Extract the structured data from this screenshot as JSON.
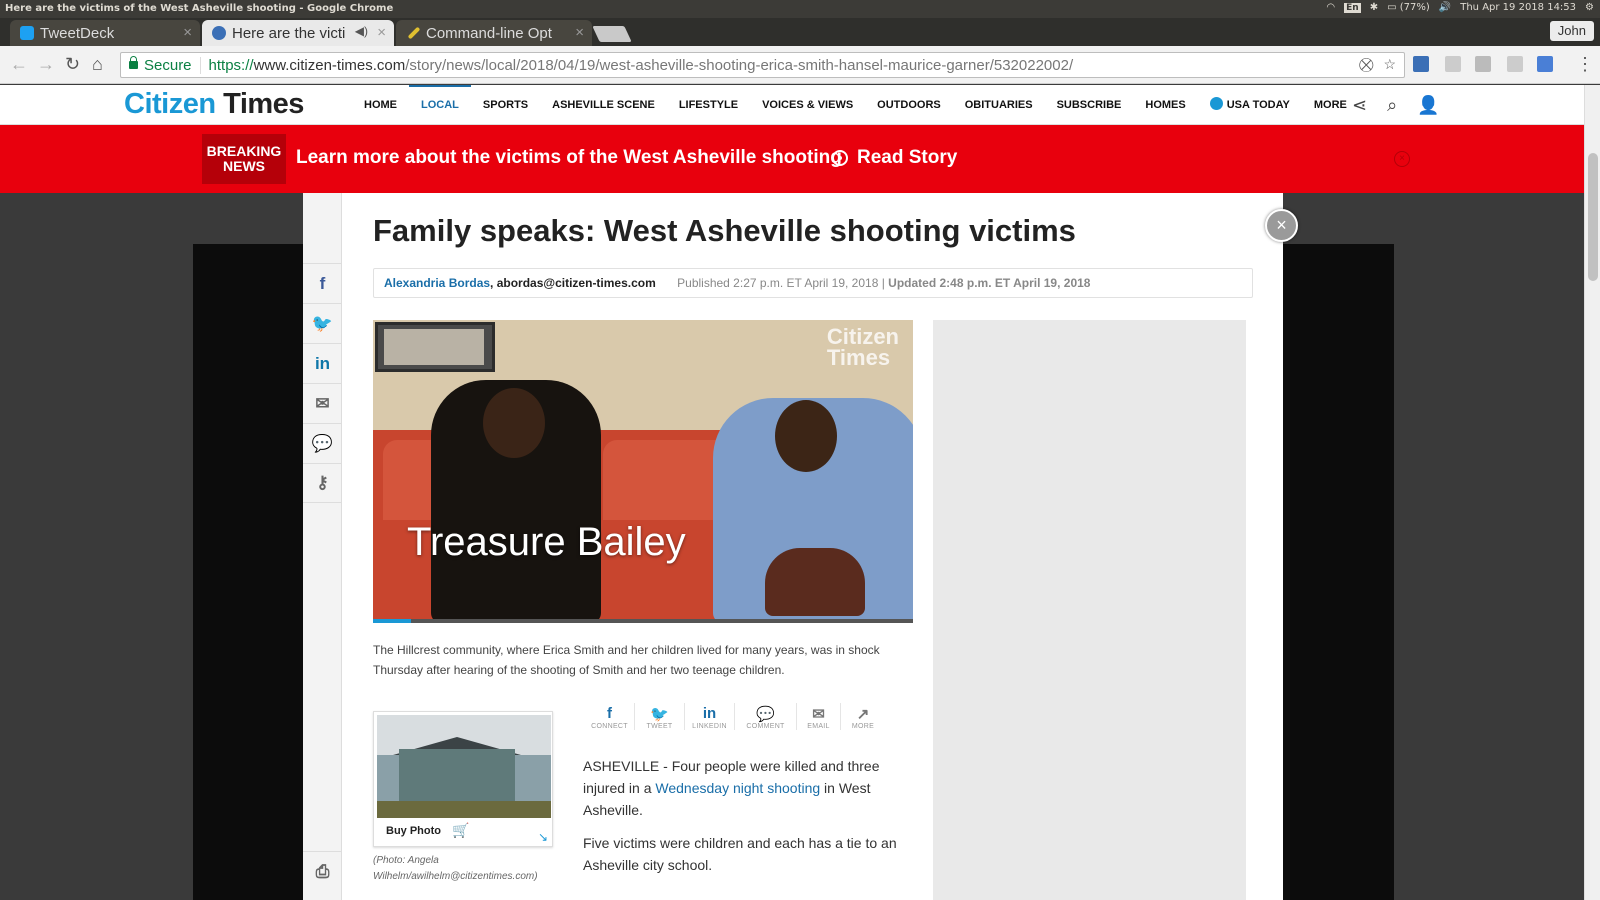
{
  "os": {
    "window_title": "Here are the victims of the West Asheville shooting - Google Chrome",
    "keyboard": "En",
    "battery": "(77%)",
    "datetime": "Thu Apr 19 2018 14:53"
  },
  "browser": {
    "tabs": [
      {
        "label": "TweetDeck",
        "favicon_color": "#1da1f2"
      },
      {
        "label": "Here are the victi",
        "favicon_color": "#3b6fb6"
      },
      {
        "label": "Command-line Opt",
        "favicon_color": "#e0c030"
      }
    ],
    "profile": "John",
    "secure_label": "Secure",
    "url_scheme": "https://",
    "url_host": "www.citizen-times.com",
    "url_path": "/story/news/local/2018/04/19/west-asheville-shooting-erica-smith-hansel-maurice-garner/532022002/"
  },
  "site": {
    "logo_part1": "Citizen",
    "logo_part2": "Times",
    "nav": [
      "HOME",
      "LOCAL",
      "SPORTS",
      "ASHEVILLE SCENE",
      "LIFESTYLE",
      "VOICES & VIEWS",
      "OUTDOORS",
      "OBITUARIES",
      "SUBSCRIBE",
      "HOMES",
      "USA TODAY",
      "MORE"
    ],
    "active_nav": "LOCAL",
    "accent_color": "#1a98d5"
  },
  "breaking": {
    "badge_line1": "BREAKING",
    "badge_line2": "NEWS",
    "headline": "Learn more about the victims of the West Asheville shooting",
    "cta": "Read Story",
    "color": "#e8000d"
  },
  "article": {
    "title": "Family speaks: West Asheville shooting victims",
    "author": "Alexandria Bordas",
    "email": ", abordas@citizen-times.com",
    "published": "Published 2:27 p.m. ET April 19, 2018 |",
    "updated": " Updated 2:48 p.m. ET April 19, 2018",
    "video": {
      "watermark_line1": "Citizen",
      "watermark_line2": "Times",
      "name_overlay": "Treasure Bailey",
      "progress": 0.07
    },
    "caption": "The Hillcrest community, where Erica Smith and her children lived for many years, was in shock Thursday after hearing of the shooting of Smith and her two teenage children.",
    "photo": {
      "buy_label": "Buy Photo",
      "credit": "(Photo: Angela Wilhelm/awilhelm@citizentimes.com)"
    },
    "share": [
      {
        "icon": "f",
        "label": "CONNECT"
      },
      {
        "icon": "t",
        "label": "TWEET"
      },
      {
        "icon": "in",
        "label": "LINKEDIN"
      },
      {
        "icon": "comment",
        "label": "COMMENT"
      },
      {
        "icon": "mail",
        "label": "EMAIL"
      },
      {
        "icon": "more",
        "label": "MORE"
      }
    ],
    "p1_before": "ASHEVILLE - Four people were killed and three injured in a ",
    "p1_link": "Wednesday night shooting",
    "p1_after": " in West Asheville.",
    "p2": "Five victims were children and each has a tie to an Asheville city school."
  }
}
